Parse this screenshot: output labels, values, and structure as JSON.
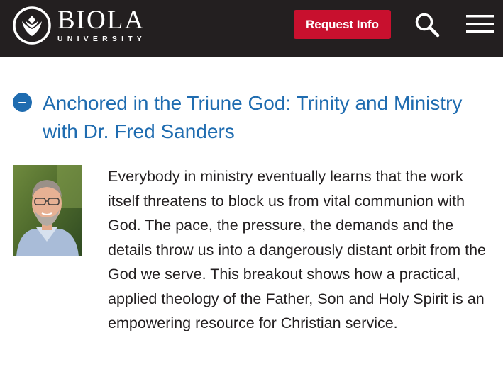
{
  "header": {
    "logo_name": "BIOLA",
    "logo_sub": "UNIVERSITY",
    "request_label": "Request Info",
    "search_icon": "search-icon",
    "menu_icon": "hamburger-menu-icon",
    "background_color": "#231f20",
    "button_color": "#c8102e"
  },
  "section": {
    "toggle_icon": "minus-circle-icon",
    "title": "Anchored in the Triune God: Trinity and Ministry with Dr. Fred Sanders",
    "title_color": "#1f6cb0",
    "body": "Everybody in ministry eventually learns that the work itself threatens to block us from vital communion with God. The pace, the pressure, the demands and the details throw us into a dangerously distant orbit from the God we serve. This breakout shows how a practical, applied theology of the Father, Son and Holy Spirit is an empowering resource for Christian service."
  }
}
